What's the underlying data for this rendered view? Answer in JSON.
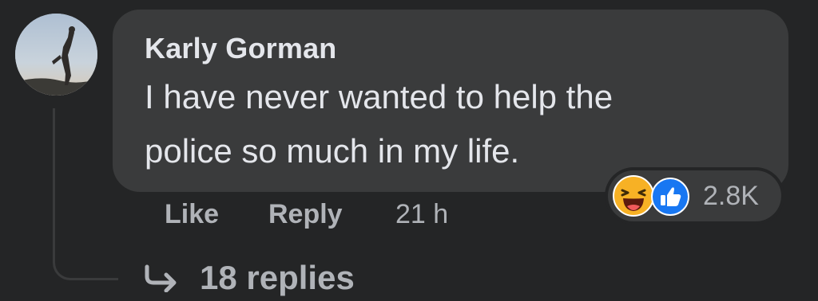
{
  "comment": {
    "author": "Karly Gorman",
    "text_line1": "I have never wanted to help the",
    "text_line2": "police so much in my life.",
    "actions": {
      "like_label": "Like",
      "reply_label": "Reply",
      "timestamp": "21 h"
    },
    "reactions": {
      "icons": [
        "haha-reaction-icon",
        "like-reaction-icon"
      ],
      "count": "2.8K"
    },
    "replies_label": "18 replies"
  },
  "colors": {
    "background": "#242526",
    "bubble": "#3a3b3c",
    "text_primary": "#e4e6eb",
    "text_secondary": "#b0b3b8",
    "like_blue": "#1877f2",
    "haha_yellow": "#f7b125"
  }
}
